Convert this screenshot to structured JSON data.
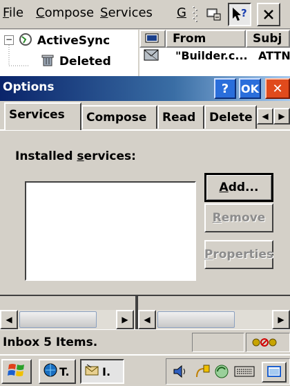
{
  "menubar": {
    "items": [
      {
        "label": "File",
        "key": "F",
        "rest": "ile"
      },
      {
        "label": "Compose",
        "key": "C",
        "rest": "ompose"
      },
      {
        "label": "Services",
        "key": "S",
        "rest": "ervices"
      },
      {
        "label": "G",
        "key": "G",
        "rest": ""
      }
    ],
    "icons": [
      "grip-icon",
      "dialup-icon",
      "help-pointer-icon",
      "close-icon"
    ]
  },
  "tree": {
    "rows": [
      {
        "label": "ActiveSync",
        "icon": "sync-icon"
      },
      {
        "label": "Deleted",
        "icon": "trash-icon"
      }
    ]
  },
  "message_list": {
    "columns": [
      "From",
      "Subj"
    ],
    "rows": [
      {
        "from": "\"Builder.c...",
        "subject": "ATTN"
      }
    ]
  },
  "dialog": {
    "title": "Options",
    "help_label": "?",
    "ok_label": "OK",
    "close_label": "✕",
    "tabs": [
      "Services",
      "Compose",
      "Read",
      "Delete"
    ],
    "active_tab": "Services",
    "installed_label_pre": "Installed ",
    "installed_label_key": "s",
    "installed_label_post": "ervices:",
    "buttons": {
      "add": {
        "key": "A",
        "rest": "dd...",
        "enabled": true
      },
      "remove": {
        "key": "R",
        "rest": "emove",
        "enabled": false
      },
      "properties": {
        "key": "P",
        "rest": "roperties",
        "enabled": false
      }
    }
  },
  "statusbar": {
    "text": "Inbox 5 Items."
  },
  "taskbar": {
    "tasks": [
      {
        "label": "T.",
        "icon": "network-icon"
      },
      {
        "label": "I.",
        "icon": "inbox-icon"
      }
    ]
  },
  "colors": {
    "title_gradient_start": "#0a246a",
    "title_gradient_end": "#a6caf0",
    "close_button": "#e04a1c",
    "face": "#d4d0c8"
  }
}
